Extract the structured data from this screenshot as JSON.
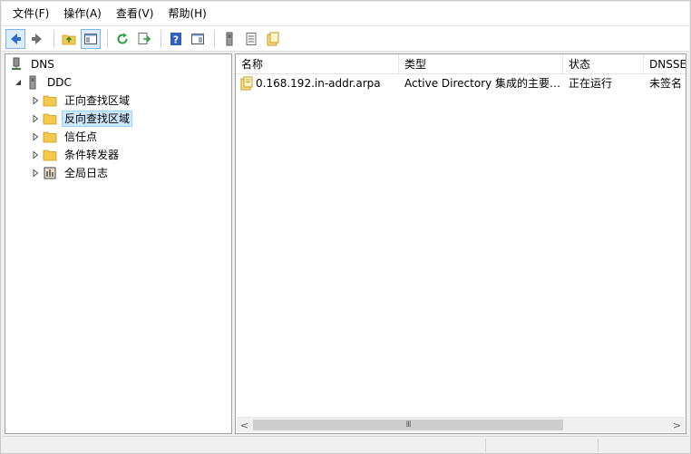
{
  "menu": {
    "items": [
      "文件(F)",
      "操作(A)",
      "查看(V)",
      "帮助(H)"
    ]
  },
  "toolbar": {
    "buttons": [
      "back-icon",
      "forward-icon",
      "up-folder-icon",
      "show-hide-tree-icon",
      "refresh-icon",
      "export-list-icon",
      "help-icon",
      "show-hide-action-pane-icon",
      "server-icon",
      "properties-list-icon",
      "zone-icon"
    ]
  },
  "tree": {
    "root": "DNS",
    "server": "DDC",
    "children": [
      "正向查找区域",
      "反向查找区域",
      "信任点",
      "条件转发器",
      "全局日志"
    ],
    "selected": "反向查找区域"
  },
  "list": {
    "columns": [
      "名称",
      "类型",
      "状态",
      "DNSSE"
    ],
    "rows": [
      {
        "name": "0.168.192.in-addr.arpa",
        "type": "Active Directory 集成的主要…",
        "status": "正在运行",
        "dnssec": "未签名"
      }
    ]
  },
  "scrollbar": {
    "left_arrow": "<",
    "right_arrow": ">",
    "thumb_grip": "III"
  },
  "colors": {
    "selection_bg": "#cce8ff",
    "selection_border": "#99d1ff",
    "folder": "#f4c84a",
    "help_blue": "#2f5fbf"
  }
}
